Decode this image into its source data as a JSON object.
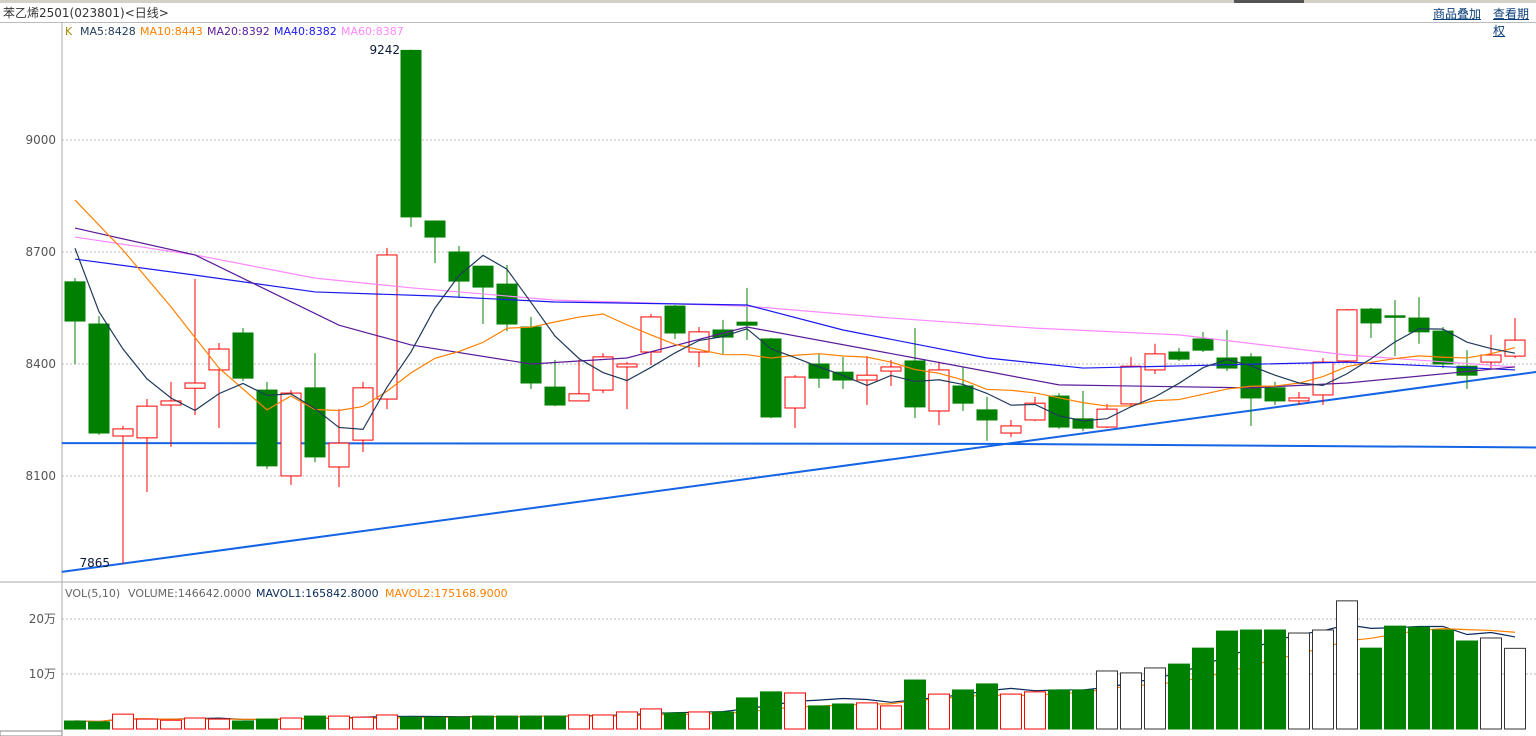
{
  "header": {
    "title": "苯乙烯2501(023801)<日线>",
    "link_overlay": "商品叠加",
    "link_view": "查看期权"
  },
  "legend_main": {
    "k": "K",
    "ma5": "MA5:8428",
    "ma10": "MA10:8443",
    "ma20": "MA20:8392",
    "ma40": "MA40:8382",
    "ma60": "MA60:8387"
  },
  "legend_vol": {
    "name": "VOL(5,10)",
    "volume": "VOLUME:146642.0000",
    "mavol1": "MAVOL1:165842.8000",
    "mavol2": "MAVOL2:175168.9000"
  },
  "colors": {
    "up": "#ff0000",
    "down": "#008000",
    "ma5": "#1f3a5a",
    "ma10": "#ff8000",
    "ma20": "#5a1a9a",
    "ma40": "#1a1aee",
    "ma60": "#ff88ff",
    "trend": "#1464e6",
    "mavol1": "#0a2a5a",
    "mavol2": "#ff8000"
  },
  "chart_data": {
    "type": "candlestick",
    "price_ticks": [
      9000,
      8700,
      8400,
      8100
    ],
    "vol_ticks": [
      {
        "v": 200000,
        "label": "20万"
      },
      {
        "v": 100000,
        "label": "10万"
      }
    ],
    "max_label": "9242",
    "min_label": "7865",
    "ohlc": [
      [
        8620,
        8515,
        8630,
        8400
      ],
      [
        8507,
        8215,
        8528,
        8210
      ],
      [
        8207,
        8226,
        8234,
        7865
      ],
      [
        8202,
        8287,
        8306,
        8057
      ],
      [
        8290,
        8301,
        8352,
        8178
      ],
      [
        8335,
        8349,
        8628,
        8263
      ],
      [
        8384,
        8440,
        8456,
        8228
      ],
      [
        8483,
        8362,
        8496,
        8354
      ],
      [
        8330,
        8127,
        8352,
        8119
      ],
      [
        8100,
        8322,
        8330,
        8076
      ],
      [
        8336,
        8151,
        8429,
        8137
      ],
      [
        8124,
        8188,
        8279,
        8070
      ],
      [
        8196,
        8336,
        8352,
        8164
      ],
      [
        8306,
        8692,
        8711,
        8279
      ],
      [
        9240,
        8794,
        9242,
        8767
      ],
      [
        8783,
        8740,
        8783,
        8670
      ],
      [
        8700,
        8622,
        8716,
        8577
      ],
      [
        8662,
        8606,
        8662,
        8507
      ],
      [
        8614,
        8507,
        8665,
        8488
      ],
      [
        8499,
        8349,
        8526,
        8333
      ],
      [
        8338,
        8290,
        8411,
        8287
      ],
      [
        8301,
        8320,
        8411,
        8301
      ],
      [
        8330,
        8419,
        8429,
        8322
      ],
      [
        8392,
        8400,
        8405,
        8279
      ],
      [
        8432,
        8526,
        8534,
        8397
      ],
      [
        8555,
        8483,
        8558,
        8467
      ],
      [
        8432,
        8486,
        8499,
        8392
      ],
      [
        8491,
        8472,
        8518,
        8427
      ],
      [
        8512,
        8504,
        8604,
        8464
      ],
      [
        8467,
        8258,
        8470,
        8255
      ],
      [
        8282,
        8365,
        8370,
        8228
      ],
      [
        8400,
        8362,
        8427,
        8336
      ],
      [
        8378,
        8357,
        8419,
        8333
      ],
      [
        8357,
        8370,
        8421,
        8290
      ],
      [
        8381,
        8392,
        8411,
        8341
      ],
      [
        8408,
        8285,
        8496,
        8255
      ],
      [
        8274,
        8384,
        8405,
        8236
      ],
      [
        8341,
        8295,
        8392,
        8274
      ],
      [
        8277,
        8250,
        8312,
        8194
      ],
      [
        8215,
        8234,
        8250,
        8204
      ],
      [
        8250,
        8295,
        8312,
        8247
      ],
      [
        8314,
        8231,
        8322,
        8226
      ],
      [
        8253,
        8228,
        8328,
        8220
      ],
      [
        8231,
        8279,
        8293,
        8228
      ],
      [
        8293,
        8394,
        8419,
        8287
      ],
      [
        8384,
        8427,
        8454,
        8373
      ],
      [
        8432,
        8413,
        8443,
        8408
      ],
      [
        8467,
        8437,
        8486,
        8432
      ],
      [
        8416,
        8389,
        8491,
        8381
      ],
      [
        8419,
        8309,
        8429,
        8234
      ],
      [
        8336,
        8301,
        8352,
        8290
      ],
      [
        8301,
        8309,
        8325,
        8290
      ],
      [
        8317,
        8405,
        8416,
        8290
      ],
      [
        8408,
        8545,
        8547,
        8405
      ],
      [
        8547,
        8510,
        8550,
        8470
      ],
      [
        8529,
        8526,
        8571,
        8421
      ],
      [
        8523,
        8486,
        8579,
        8454
      ],
      [
        8488,
        8400,
        8499,
        8389
      ],
      [
        8394,
        8370,
        8437,
        8333
      ],
      [
        8405,
        8424,
        8478,
        8389
      ],
      [
        8421,
        8464,
        8523,
        8416
      ]
    ],
    "volume": [
      14500,
      13000,
      27000,
      18000,
      16000,
      20000,
      18000,
      14500,
      18000,
      20000,
      23500,
      23500,
      21500,
      25500,
      21500,
      21500,
      21500,
      23500,
      23500,
      23500,
      23500,
      25500,
      25500,
      31000,
      36500,
      29000,
      31000,
      31000,
      56500,
      67500,
      65500,
      42000,
      45500,
      47500,
      42000,
      89000,
      63500,
      71000,
      82000,
      63500,
      67500,
      71000,
      71000,
      105500,
      102000,
      111000,
      118000,
      147000,
      178000,
      180000,
      180000,
      174500,
      180000,
      233000,
      147000,
      187000,
      185000,
      180000,
      160000,
      165500,
      146642
    ],
    "ma5_early": [
      [
        0,
        8710
      ],
      [
        1,
        8540
      ],
      [
        2,
        8440
      ],
      [
        3,
        8360
      ]
    ],
    "ma10_early": [
      [
        0,
        8839
      ],
      [
        2,
        8705
      ],
      [
        4,
        8553
      ],
      [
        6,
        8389
      ],
      [
        8,
        8277
      ]
    ],
    "ma20": [
      [
        0,
        8764
      ],
      [
        5,
        8692
      ],
      [
        8,
        8598
      ],
      [
        11,
        8504
      ],
      [
        14,
        8451
      ],
      [
        19,
        8400
      ],
      [
        23,
        8416
      ],
      [
        28,
        8499
      ],
      [
        35,
        8416
      ],
      [
        41,
        8344
      ],
      [
        49,
        8336
      ],
      [
        53,
        8349
      ],
      [
        60,
        8392
      ]
    ],
    "ma40": [
      [
        0,
        8681
      ],
      [
        5,
        8638
      ],
      [
        10,
        8593
      ],
      [
        15,
        8582
      ],
      [
        20,
        8566
      ],
      [
        28,
        8558
      ],
      [
        32,
        8491
      ],
      [
        38,
        8416
      ],
      [
        42,
        8389
      ],
      [
        53,
        8405
      ],
      [
        60,
        8384
      ]
    ],
    "ma60": [
      [
        0,
        8740
      ],
      [
        5,
        8692
      ],
      [
        10,
        8630
      ],
      [
        14,
        8604
      ],
      [
        20,
        8571
      ],
      [
        28,
        8555
      ],
      [
        34,
        8523
      ],
      [
        40,
        8496
      ],
      [
        46,
        8478
      ],
      [
        53,
        8424
      ],
      [
        60,
        8392
      ]
    ],
    "trendlines": [
      {
        "from": [
          -0.55,
          8188
        ],
        "to": [
          38,
          8186
        ]
      },
      {
        "from": [
          38,
          8186
        ],
        "to": [
          61.5,
          8176
        ]
      },
      {
        "from": [
          -0.55,
          7843
        ],
        "to": [
          61.5,
          8384
        ]
      }
    ]
  }
}
